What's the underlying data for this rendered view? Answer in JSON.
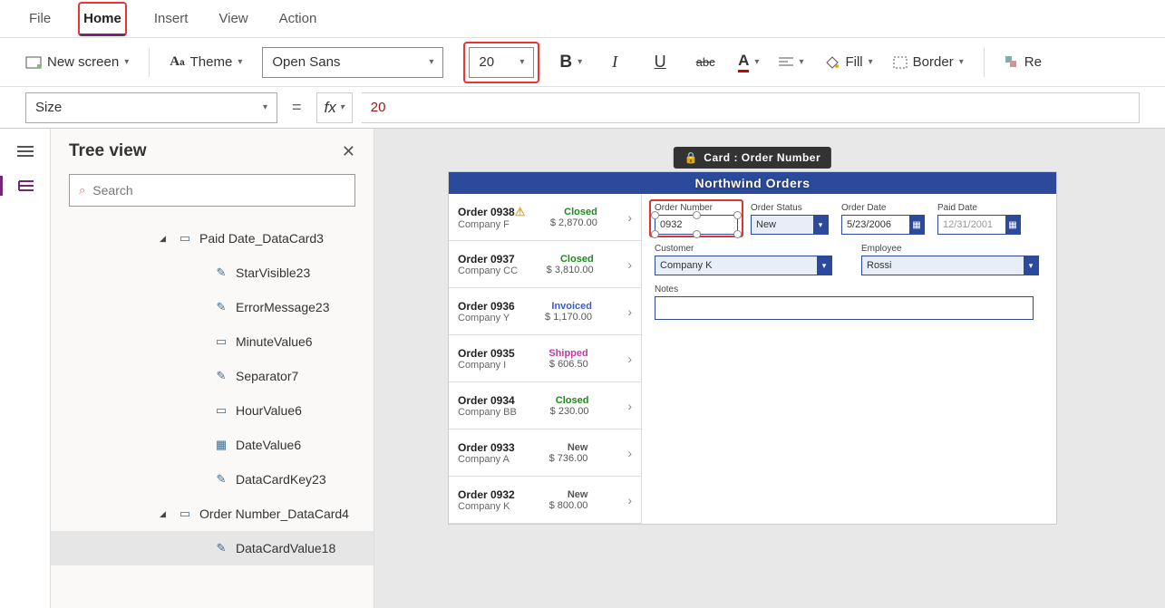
{
  "menu": {
    "file": "File",
    "home": "Home",
    "insert": "Insert",
    "view": "View",
    "action": "Action"
  },
  "toolbar": {
    "new_screen": "New screen",
    "theme": "Theme",
    "font": "Open Sans",
    "size": "20",
    "fill": "Fill",
    "border": "Border",
    "reorder": "Re"
  },
  "formula": {
    "property": "Size",
    "fx": "fx",
    "value": "20"
  },
  "tree": {
    "title": "Tree view",
    "search_ph": "Search",
    "nodes": [
      {
        "depth": 1,
        "exp": true,
        "icon": "card",
        "label": "Paid Date_DataCard3"
      },
      {
        "depth": 2,
        "icon": "edit",
        "label": "StarVisible23"
      },
      {
        "depth": 2,
        "icon": "edit",
        "label": "ErrorMessage23"
      },
      {
        "depth": 2,
        "icon": "input",
        "label": "MinuteValue6"
      },
      {
        "depth": 2,
        "icon": "edit",
        "label": "Separator7"
      },
      {
        "depth": 2,
        "icon": "input",
        "label": "HourValue6"
      },
      {
        "depth": 2,
        "icon": "date",
        "label": "DateValue6"
      },
      {
        "depth": 2,
        "icon": "edit",
        "label": "DataCardKey23"
      },
      {
        "depth": 1,
        "exp": true,
        "icon": "card",
        "label": "Order Number_DataCard4"
      },
      {
        "depth": 2,
        "icon": "edit",
        "label": "DataCardValue18",
        "sel": true
      }
    ]
  },
  "selection_badge": "Card : Order Number",
  "app": {
    "title": "Northwind Orders",
    "orders": [
      {
        "id": "Order 0938",
        "co": "Company F",
        "status": "Closed",
        "scls": "st-closed",
        "amt": "$ 2,870.00",
        "warn": true
      },
      {
        "id": "Order 0937",
        "co": "Company CC",
        "status": "Closed",
        "scls": "st-closed",
        "amt": "$ 3,810.00"
      },
      {
        "id": "Order 0936",
        "co": "Company Y",
        "status": "Invoiced",
        "scls": "st-invoiced",
        "amt": "$ 1,170.00"
      },
      {
        "id": "Order 0935",
        "co": "Company I",
        "status": "Shipped",
        "scls": "st-shipped",
        "amt": "$ 606.50"
      },
      {
        "id": "Order 0934",
        "co": "Company BB",
        "status": "Closed",
        "scls": "st-closed",
        "amt": "$ 230.00"
      },
      {
        "id": "Order 0933",
        "co": "Company A",
        "status": "New",
        "scls": "st-new",
        "amt": "$ 736.00"
      },
      {
        "id": "Order 0932",
        "co": "Company K",
        "status": "New",
        "scls": "st-new",
        "amt": "$ 800.00"
      }
    ],
    "form": {
      "order_number": {
        "label": "Order Number",
        "value": "0932"
      },
      "order_status": {
        "label": "Order Status",
        "value": "New"
      },
      "order_date": {
        "label": "Order Date",
        "value": "5/23/2006"
      },
      "paid_date": {
        "label": "Paid Date",
        "value": "12/31/2001"
      },
      "customer": {
        "label": "Customer",
        "value": "Company K"
      },
      "employee": {
        "label": "Employee",
        "value": "Rossi"
      },
      "notes": {
        "label": "Notes",
        "value": ""
      }
    }
  }
}
